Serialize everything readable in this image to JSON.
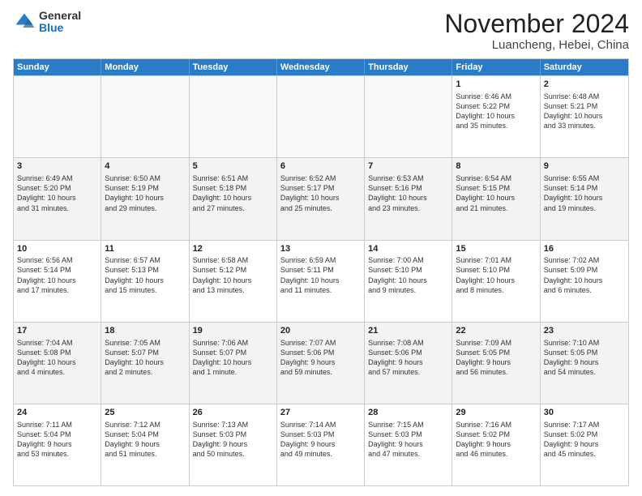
{
  "logo": {
    "general": "General",
    "blue": "Blue"
  },
  "title": "November 2024",
  "location": "Luancheng, Hebei, China",
  "weekdays": [
    "Sunday",
    "Monday",
    "Tuesday",
    "Wednesday",
    "Thursday",
    "Friday",
    "Saturday"
  ],
  "weeks": [
    [
      {
        "day": "",
        "info": "",
        "empty": true
      },
      {
        "day": "",
        "info": "",
        "empty": true
      },
      {
        "day": "",
        "info": "",
        "empty": true
      },
      {
        "day": "",
        "info": "",
        "empty": true
      },
      {
        "day": "",
        "info": "",
        "empty": true
      },
      {
        "day": "1",
        "info": "Sunrise: 6:46 AM\nSunset: 5:22 PM\nDaylight: 10 hours\nand 35 minutes."
      },
      {
        "day": "2",
        "info": "Sunrise: 6:48 AM\nSunset: 5:21 PM\nDaylight: 10 hours\nand 33 minutes."
      }
    ],
    [
      {
        "day": "3",
        "info": "Sunrise: 6:49 AM\nSunset: 5:20 PM\nDaylight: 10 hours\nand 31 minutes."
      },
      {
        "day": "4",
        "info": "Sunrise: 6:50 AM\nSunset: 5:19 PM\nDaylight: 10 hours\nand 29 minutes."
      },
      {
        "day": "5",
        "info": "Sunrise: 6:51 AM\nSunset: 5:18 PM\nDaylight: 10 hours\nand 27 minutes."
      },
      {
        "day": "6",
        "info": "Sunrise: 6:52 AM\nSunset: 5:17 PM\nDaylight: 10 hours\nand 25 minutes."
      },
      {
        "day": "7",
        "info": "Sunrise: 6:53 AM\nSunset: 5:16 PM\nDaylight: 10 hours\nand 23 minutes."
      },
      {
        "day": "8",
        "info": "Sunrise: 6:54 AM\nSunset: 5:15 PM\nDaylight: 10 hours\nand 21 minutes."
      },
      {
        "day": "9",
        "info": "Sunrise: 6:55 AM\nSunset: 5:14 PM\nDaylight: 10 hours\nand 19 minutes."
      }
    ],
    [
      {
        "day": "10",
        "info": "Sunrise: 6:56 AM\nSunset: 5:14 PM\nDaylight: 10 hours\nand 17 minutes."
      },
      {
        "day": "11",
        "info": "Sunrise: 6:57 AM\nSunset: 5:13 PM\nDaylight: 10 hours\nand 15 minutes."
      },
      {
        "day": "12",
        "info": "Sunrise: 6:58 AM\nSunset: 5:12 PM\nDaylight: 10 hours\nand 13 minutes."
      },
      {
        "day": "13",
        "info": "Sunrise: 6:59 AM\nSunset: 5:11 PM\nDaylight: 10 hours\nand 11 minutes."
      },
      {
        "day": "14",
        "info": "Sunrise: 7:00 AM\nSunset: 5:10 PM\nDaylight: 10 hours\nand 9 minutes."
      },
      {
        "day": "15",
        "info": "Sunrise: 7:01 AM\nSunset: 5:10 PM\nDaylight: 10 hours\nand 8 minutes."
      },
      {
        "day": "16",
        "info": "Sunrise: 7:02 AM\nSunset: 5:09 PM\nDaylight: 10 hours\nand 6 minutes."
      }
    ],
    [
      {
        "day": "17",
        "info": "Sunrise: 7:04 AM\nSunset: 5:08 PM\nDaylight: 10 hours\nand 4 minutes."
      },
      {
        "day": "18",
        "info": "Sunrise: 7:05 AM\nSunset: 5:07 PM\nDaylight: 10 hours\nand 2 minutes."
      },
      {
        "day": "19",
        "info": "Sunrise: 7:06 AM\nSunset: 5:07 PM\nDaylight: 10 hours\nand 1 minute."
      },
      {
        "day": "20",
        "info": "Sunrise: 7:07 AM\nSunset: 5:06 PM\nDaylight: 9 hours\nand 59 minutes."
      },
      {
        "day": "21",
        "info": "Sunrise: 7:08 AM\nSunset: 5:06 PM\nDaylight: 9 hours\nand 57 minutes."
      },
      {
        "day": "22",
        "info": "Sunrise: 7:09 AM\nSunset: 5:05 PM\nDaylight: 9 hours\nand 56 minutes."
      },
      {
        "day": "23",
        "info": "Sunrise: 7:10 AM\nSunset: 5:05 PM\nDaylight: 9 hours\nand 54 minutes."
      }
    ],
    [
      {
        "day": "24",
        "info": "Sunrise: 7:11 AM\nSunset: 5:04 PM\nDaylight: 9 hours\nand 53 minutes."
      },
      {
        "day": "25",
        "info": "Sunrise: 7:12 AM\nSunset: 5:04 PM\nDaylight: 9 hours\nand 51 minutes."
      },
      {
        "day": "26",
        "info": "Sunrise: 7:13 AM\nSunset: 5:03 PM\nDaylight: 9 hours\nand 50 minutes."
      },
      {
        "day": "27",
        "info": "Sunrise: 7:14 AM\nSunset: 5:03 PM\nDaylight: 9 hours\nand 49 minutes."
      },
      {
        "day": "28",
        "info": "Sunrise: 7:15 AM\nSunset: 5:03 PM\nDaylight: 9 hours\nand 47 minutes."
      },
      {
        "day": "29",
        "info": "Sunrise: 7:16 AM\nSunset: 5:02 PM\nDaylight: 9 hours\nand 46 minutes."
      },
      {
        "day": "30",
        "info": "Sunrise: 7:17 AM\nSunset: 5:02 PM\nDaylight: 9 hours\nand 45 minutes."
      }
    ]
  ]
}
